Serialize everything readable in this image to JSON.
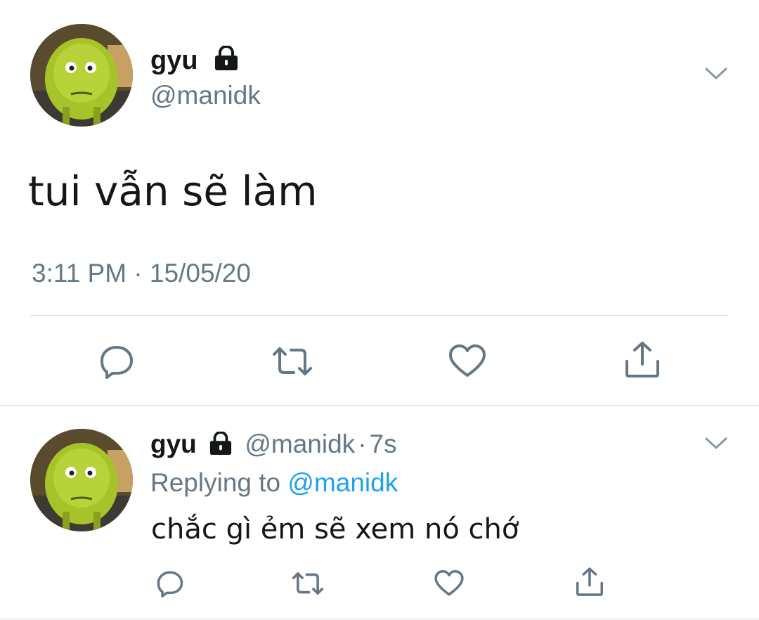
{
  "main_tweet": {
    "display_name": "gyu",
    "handle": "@manidk",
    "text": "tui vẫn sẽ làm",
    "timestamp": "3:11 PM · 15/05/20",
    "icons": {
      "lock": "lock-icon",
      "menu": "chevron-down-icon",
      "actions": [
        "reply-icon",
        "retweet-icon",
        "like-icon",
        "share-icon"
      ]
    }
  },
  "reply_tweet": {
    "display_name": "gyu",
    "handle": "@manidk",
    "separator": "·",
    "age": "7s",
    "replying_prefix": "Replying to",
    "replying_to": "@manidk",
    "text": "chắc gì ẻm sẽ xem nó chớ",
    "icons": {
      "lock": "lock-icon",
      "menu": "chevron-down-icon",
      "actions": [
        "reply-icon",
        "retweet-icon",
        "like-icon",
        "share-icon"
      ]
    }
  },
  "colors": {
    "text": "#14171a",
    "muted": "#657786",
    "link": "#1da1f2",
    "divider": "#ccd6dd",
    "avatar": "#a8c42e"
  }
}
